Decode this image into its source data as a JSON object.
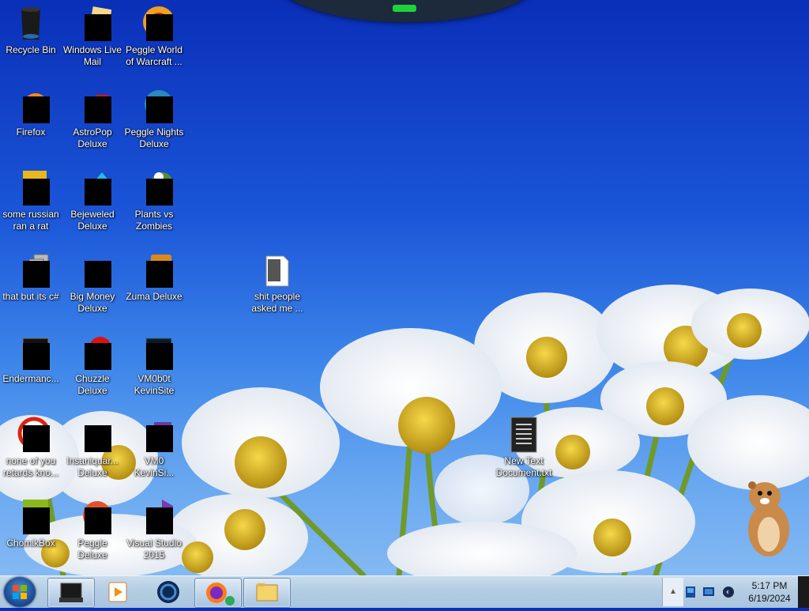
{
  "desktop_icons": [
    {
      "label": "Recycle Bin",
      "icon": "recycle-bin-icon",
      "redacted": false
    },
    {
      "label": "Windows Live Mail",
      "icon": "windows-live-mail-icon",
      "redacted": true
    },
    {
      "label": "Peggle World of Warcraft ...",
      "icon": "peggle-wow-icon",
      "redacted": true
    },
    {
      "label": "Firefox",
      "icon": "firefox-icon",
      "redacted": true
    },
    {
      "label": "AstroPop Deluxe",
      "icon": "astropop-icon",
      "redacted": true
    },
    {
      "label": "Peggle Nights Deluxe",
      "icon": "peggle-nights-icon",
      "redacted": true
    },
    {
      "label": "some russian ran a rat",
      "icon": "shortcut-icon",
      "redacted": true
    },
    {
      "label": "Bejeweled Deluxe",
      "icon": "bejeweled-icon",
      "redacted": true
    },
    {
      "label": "Plants vs Zombies",
      "icon": "plants-vs-zombies-icon",
      "redacted": true
    },
    {
      "label": "that but its c#",
      "icon": "shortcut-icon",
      "redacted": true
    },
    {
      "label": "Big Money Deluxe",
      "icon": "big-money-icon",
      "redacted": true
    },
    {
      "label": "Zuma Deluxe",
      "icon": "zuma-icon",
      "redacted": true
    },
    {
      "label": "shit people asked me ...",
      "icon": "folder-icon",
      "redacted": false
    },
    {
      "label": "Endermanc...",
      "icon": "terminal-icon",
      "redacted": true
    },
    {
      "label": "Chuzzle Deluxe",
      "icon": "chuzzle-icon",
      "redacted": true
    },
    {
      "label": "VM0b0t KevinSite",
      "icon": "terminal-icon",
      "redacted": true
    },
    {
      "label": "none of you retards kno...",
      "icon": "shortcut-icon",
      "redacted": true
    },
    {
      "label": "Insaniquar... Deluxe",
      "icon": "insaniquarium-icon",
      "redacted": true
    },
    {
      "label": "VM0 KevinSi...",
      "icon": "shortcut-icon",
      "redacted": true
    },
    {
      "label": "New Text Document.txt",
      "icon": "text-document-icon",
      "redacted": false
    },
    {
      "label": "ChomikBox",
      "icon": "chomikbox-icon",
      "redacted": true
    },
    {
      "label": "Peggle Deluxe",
      "icon": "peggle-icon",
      "redacted": true
    },
    {
      "label": "Visual Studio 2015",
      "icon": "visual-studio-icon",
      "redacted": true
    }
  ],
  "taskbar": {
    "pinned": [
      {
        "name": "terminal",
        "icon": "terminal-icon",
        "active": true
      },
      {
        "name": "media player",
        "icon": "media-player-icon",
        "active": false
      },
      {
        "name": "browser",
        "icon": "globe-icon",
        "active": false
      },
      {
        "name": "firefox",
        "icon": "firefox-icon",
        "active": true
      },
      {
        "name": "explorer",
        "icon": "folder-icon",
        "active": true
      }
    ],
    "tray_arrow": "▲",
    "time": "5:17 PM",
    "date": "6/19/2024"
  },
  "colors": {
    "sky_top": "#0a2fb8",
    "taskbar": "#b3cde3",
    "redaction": "#000000"
  }
}
